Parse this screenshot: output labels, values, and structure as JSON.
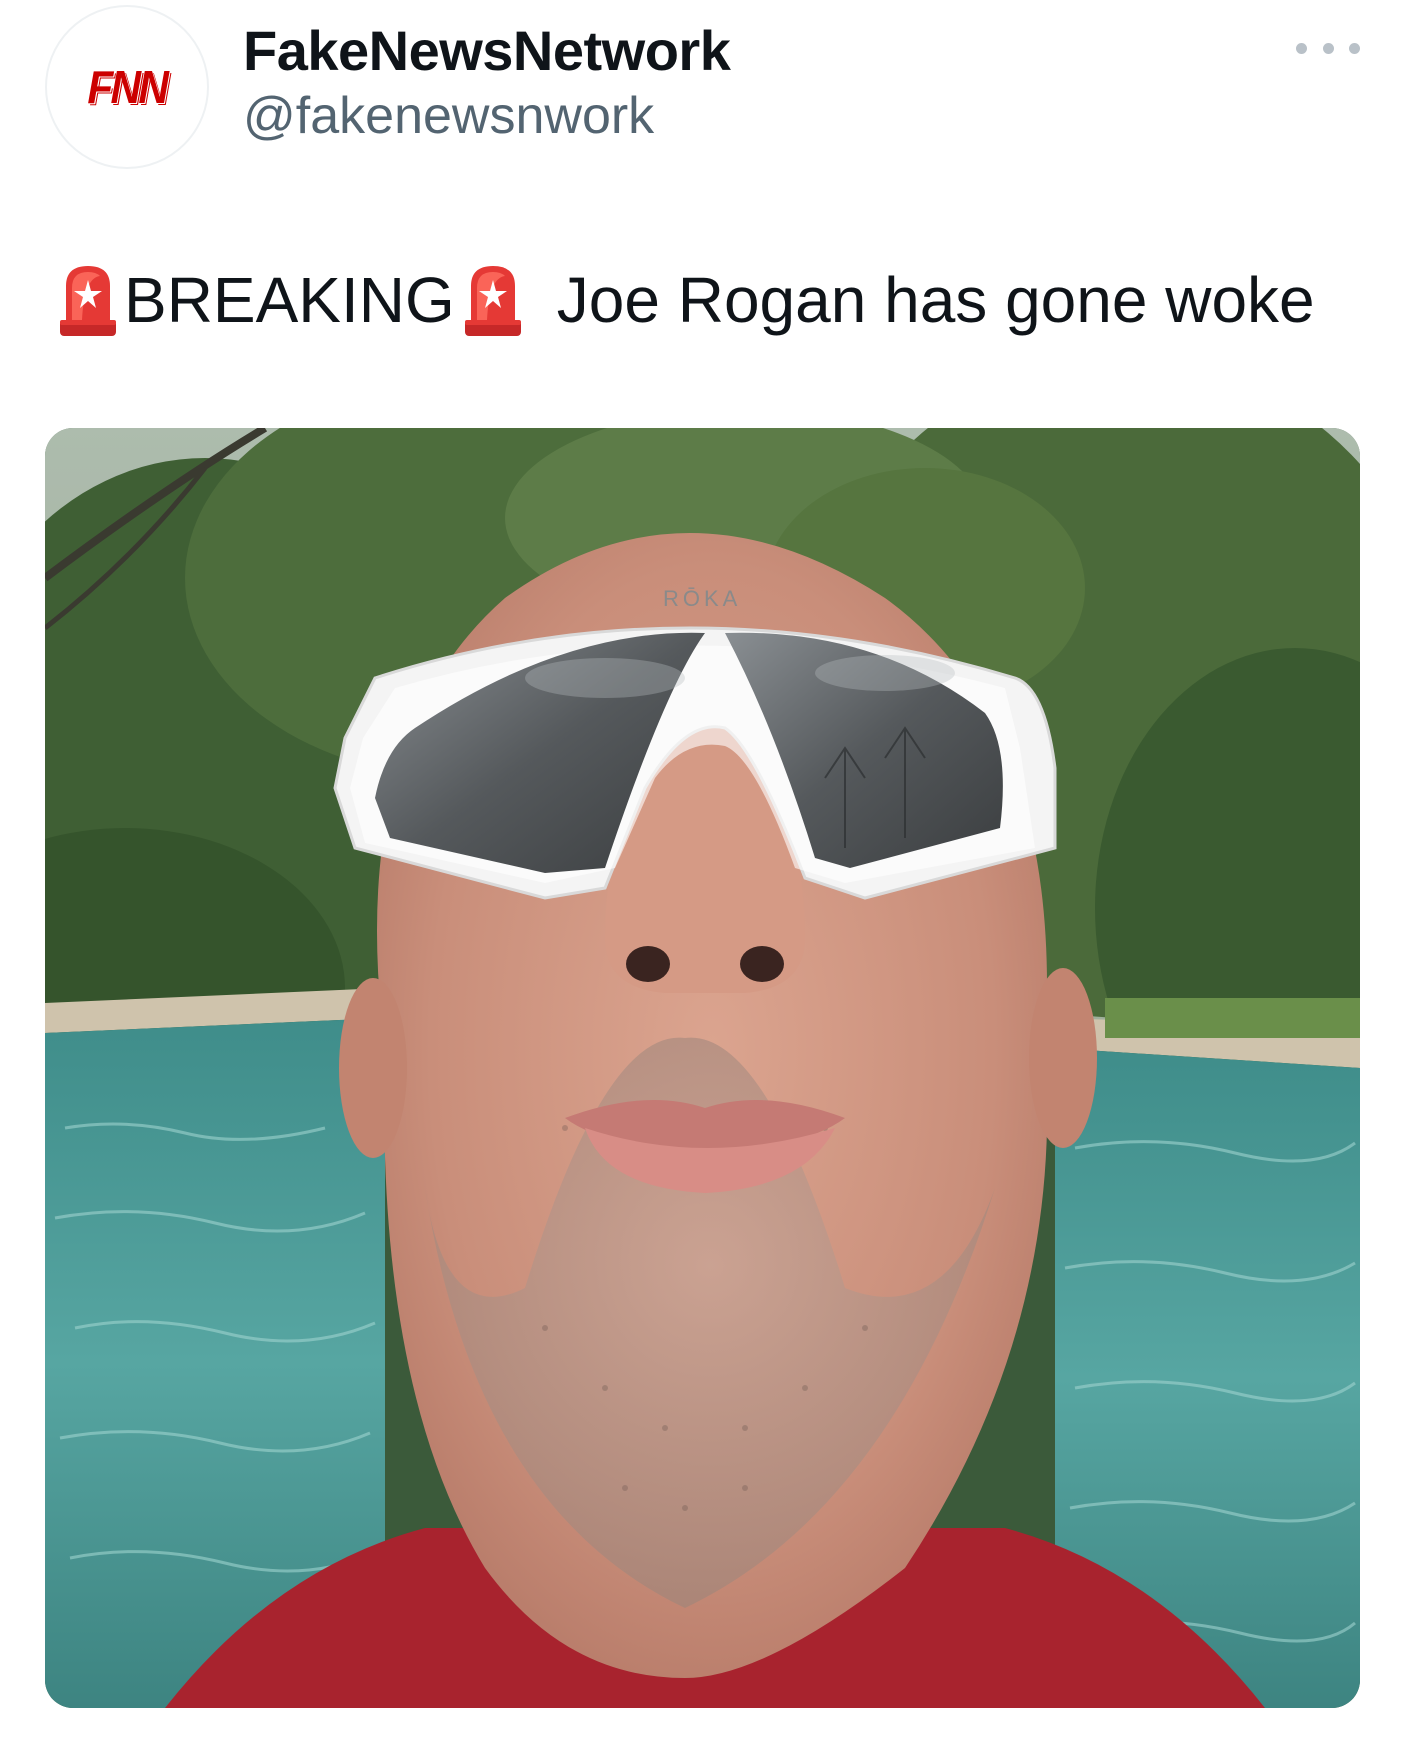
{
  "account": {
    "display_name": "FakeNewsNetwork",
    "handle": "@fakenewsnwork",
    "avatar_logo_text": "FNN"
  },
  "tweet": {
    "breaking_label": "BREAKING",
    "message": "Joe Rogan has gone woke",
    "emoji": "police-car-light-icon"
  },
  "media": {
    "goggle_brand_text": "RŌKA"
  },
  "colors": {
    "brand_red": "#cc0000",
    "text_primary": "#0f1419",
    "text_secondary": "#536471"
  }
}
